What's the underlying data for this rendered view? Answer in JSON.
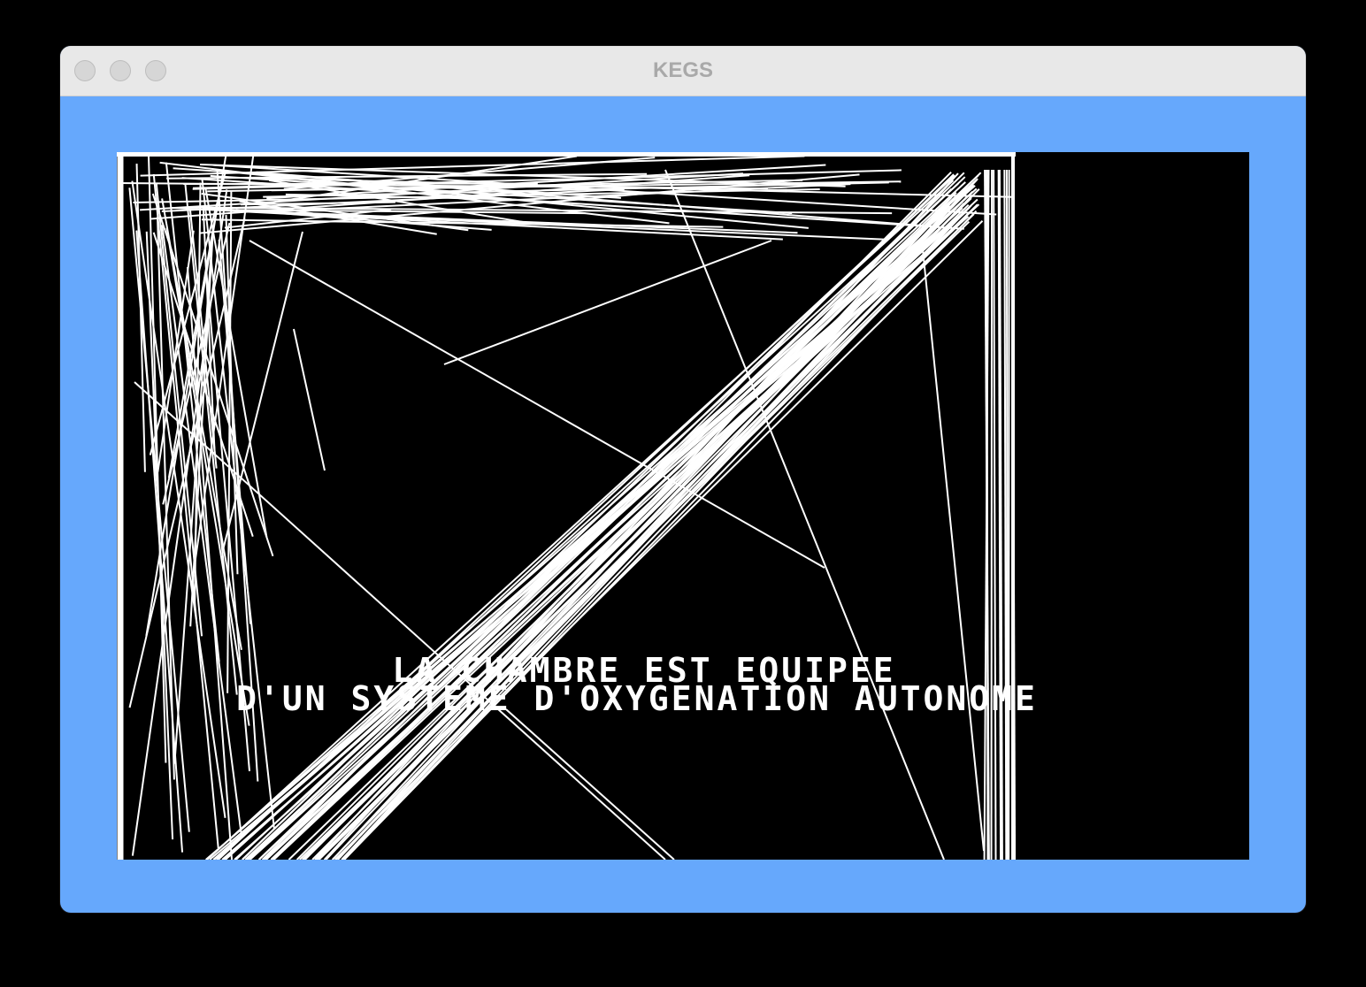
{
  "window": {
    "title": "KEGS"
  },
  "screen": {
    "caption_line1": "LA CHAMBRE EST EQUIPEE",
    "caption_line2": "D'UN SYSTEME D'OXYGENATION AUTONOME"
  },
  "colors": {
    "border": "#66a8fc",
    "screen_bg": "#000000",
    "line": "#ffffff"
  }
}
